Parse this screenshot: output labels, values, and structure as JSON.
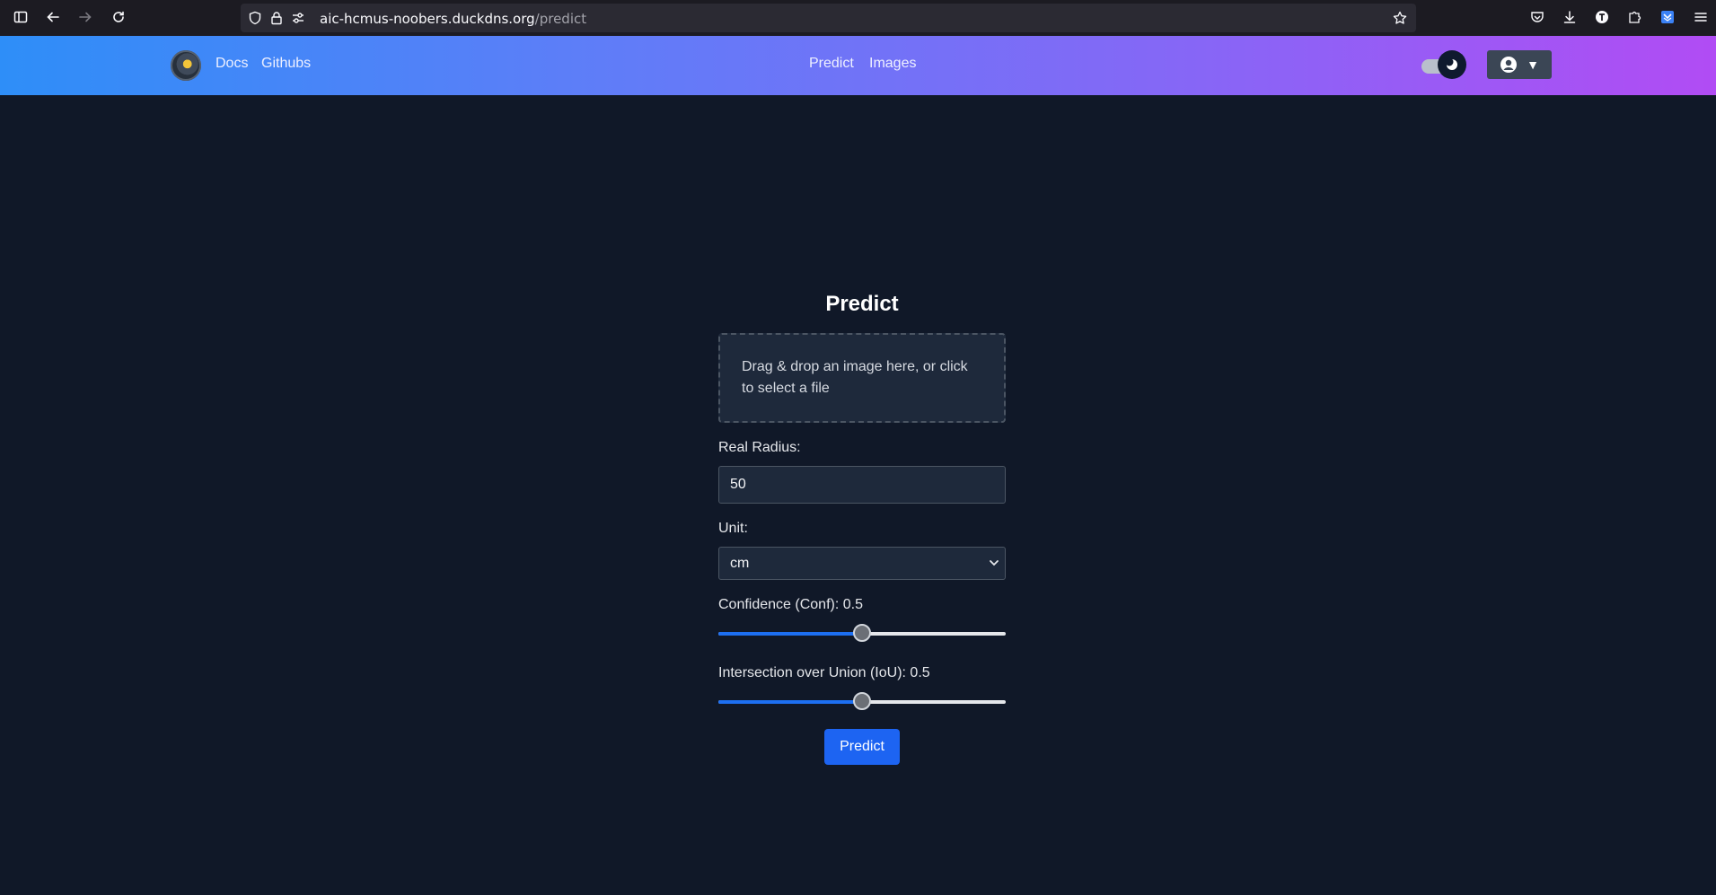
{
  "browser": {
    "url_host": "aic-hcmus-noobers.duckdns.org",
    "url_path": "/predict"
  },
  "navbar": {
    "left_links": [
      "Docs",
      "Githubs"
    ],
    "center_links": [
      "Predict",
      "Images"
    ],
    "theme": "dark",
    "brand_color_start": "#2e8ef8",
    "brand_color_end": "#b14cf4"
  },
  "form": {
    "title": "Predict",
    "dropzone_text": "Drag & drop an image here, or click to select a file",
    "radius_label": "Real Radius:",
    "radius_value": "50",
    "unit_label": "Unit:",
    "unit_value": "cm",
    "conf_label": "Confidence (Conf): 0.5",
    "conf_value": 0.5,
    "iou_label": "Intersection over Union (IoU): 0.5",
    "iou_value": 0.5,
    "submit_label": "Predict",
    "accent_color": "#1d64f2"
  }
}
